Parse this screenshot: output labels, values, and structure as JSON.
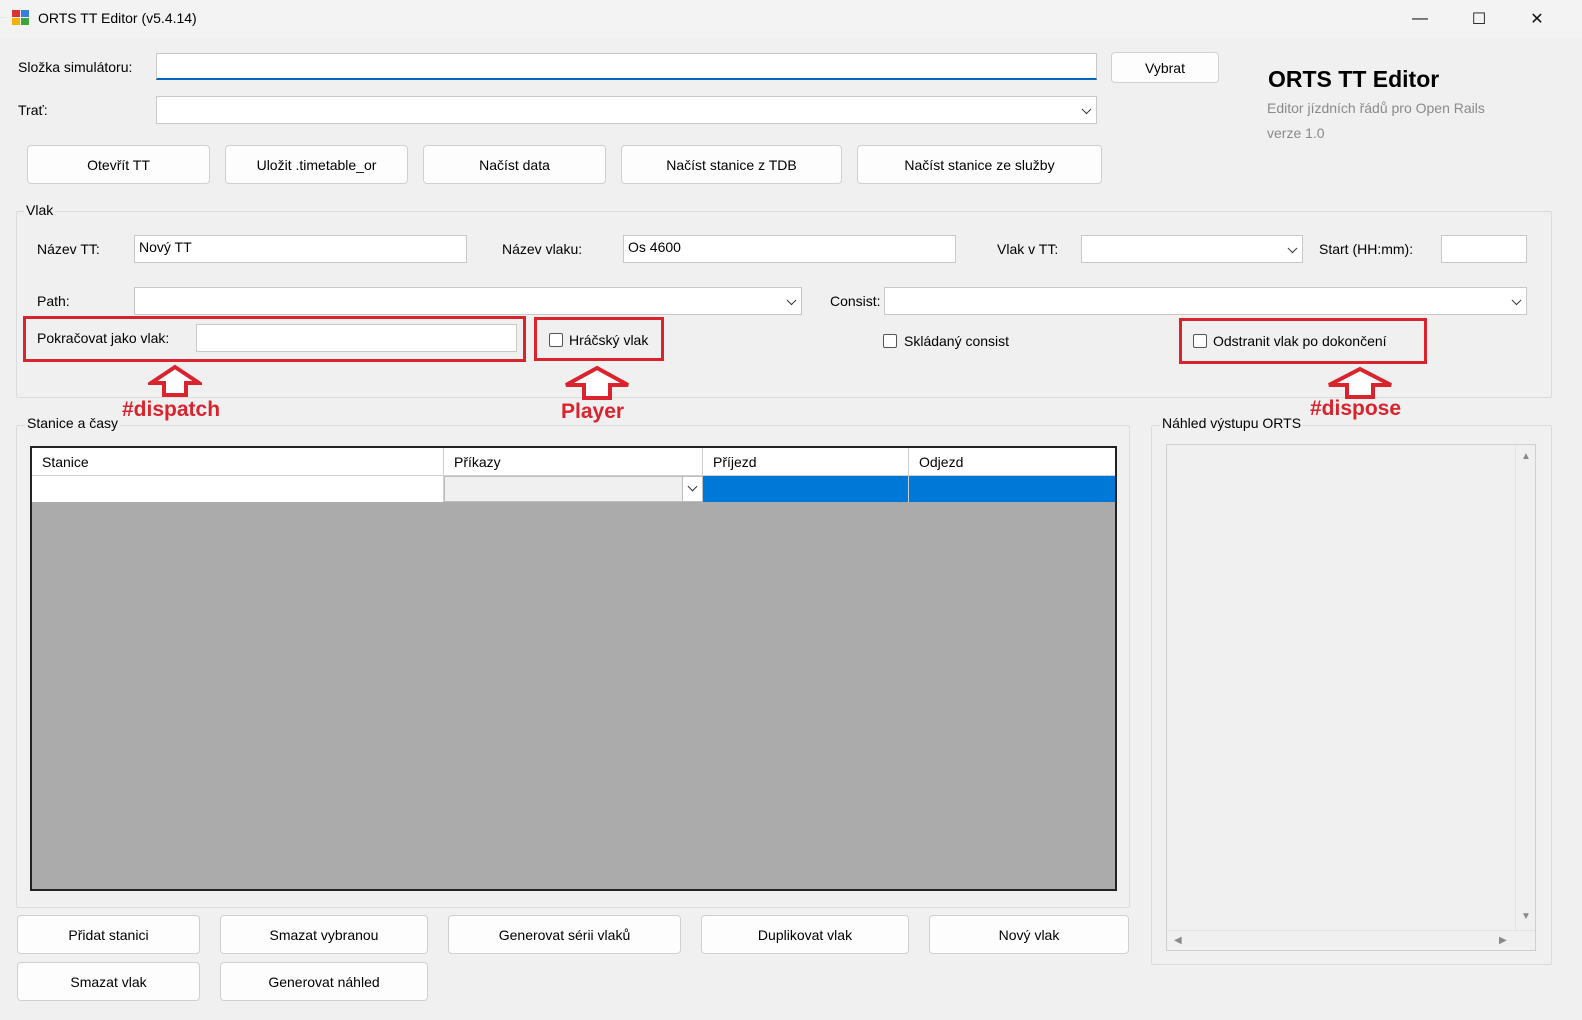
{
  "window": {
    "title": "ORTS TT Editor (v5.4.14)",
    "min": "—",
    "max": "☐",
    "close": "✕"
  },
  "brand": {
    "title": "ORTS TT Editor",
    "subtitle": "Editor jízdních řádů pro Open Rails",
    "version": "verze 1.0"
  },
  "sim": {
    "label": "Složka simulátoru:",
    "value": "",
    "browse": "Vybrat"
  },
  "route": {
    "label": "Trať:",
    "value": ""
  },
  "toolbar": {
    "open": "Otevřít TT",
    "save": "Uložit .timetable_or",
    "load_data": "Načíst data",
    "load_tdb": "Načíst stanice z TDB",
    "load_service": "Načíst stanice ze služby"
  },
  "train": {
    "group": "Vlak",
    "tt_name_label": "Název TT:",
    "tt_name": "Nový TT",
    "train_name_label": "Název vlaku:",
    "train_name": "Os 4600",
    "train_in_tt_label": "Vlak v TT:",
    "train_in_tt": "",
    "start_label": "Start (HH:mm):",
    "start": "",
    "path_label": "Path:",
    "path": "",
    "consist_label": "Consist:",
    "consist": "",
    "continue_label": "Pokračovat jako vlak:",
    "continue_value": "",
    "player_label": "Hráčský vlak",
    "stacked_label": "Skládaný consist",
    "dispose_label": "Odstranit vlak po dokončení"
  },
  "annotations": {
    "dispatch": "#dispatch",
    "player": "Player",
    "dispose": "#dispose",
    "color": "#d9232d"
  },
  "stations": {
    "group": "Stanice a časy",
    "columns": [
      "Stanice",
      "Příkazy",
      "Příjezd",
      "Odjezd"
    ]
  },
  "preview": {
    "group": "Náhled výstupu ORTS"
  },
  "bottom": {
    "add_station": "Přidat stanici",
    "delete_selected": "Smazat vybranou",
    "generate_series": "Generovat sérii vlaků",
    "duplicate": "Duplikovat vlak",
    "new_train": "Nový vlak",
    "delete_train": "Smazat vlak",
    "generate_preview": "Generovat náhled"
  },
  "colors": {
    "accent": "#0067c0",
    "selection": "#0078d7",
    "grid_bg": "#ababab"
  }
}
